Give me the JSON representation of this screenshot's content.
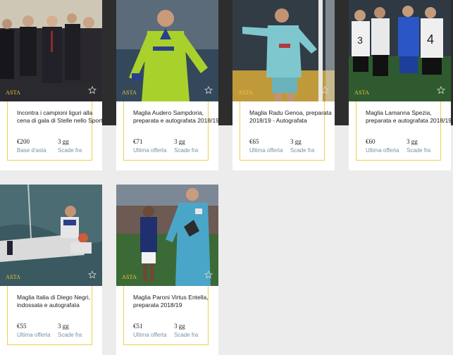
{
  "colors": {
    "accent": "#f1cf50",
    "tag": "#f3c738",
    "label": "#7a8fa6",
    "dark_band": "#2d2d2d",
    "page_bg": "#ececec"
  },
  "cards": [
    {
      "tag": "ASTA",
      "title": "Incontra i campioni liguri alla cena di gala di Stelle nello Sport",
      "price": "€200",
      "price_label": "Base d'asta",
      "days": "3 gg",
      "days_label": "Scade fra",
      "icon": "star-outline-icon"
    },
    {
      "tag": "ASTA",
      "title": "Maglia Audero Sampdoria, preparata e autografata 2018/19",
      "price": "€71",
      "price_label": "Ultima offerta",
      "days": "3 gg",
      "days_label": "Scade fra",
      "icon": "star-outline-icon"
    },
    {
      "tag": "ASTA",
      "title": "Maglia Radu Genoa, preparata 2018/19 - Autografata",
      "price": "€65",
      "price_label": "Ultima offerta",
      "days": "3 gg",
      "days_label": "Scade fra",
      "icon": "star-outline-icon"
    },
    {
      "tag": "ASTA",
      "title": "Maglia Lamanna Spezia, preparata e autografata 2018/19",
      "price": "€60",
      "price_label": "Ultima offerta",
      "days": "3 gg",
      "days_label": "Scade fra",
      "icon": "star-outline-icon"
    },
    {
      "tag": "ASTA",
      "title": "Maglia Italia di Diego Negri, indossata e autografata",
      "price": "€55",
      "price_label": "Ultima offerta",
      "days": "3 gg",
      "days_label": "Scade fra",
      "icon": "star-outline-icon"
    },
    {
      "tag": "ASTA",
      "title": "Maglia Paroni Virtus Entella, preparata 2018/19",
      "price": "€51",
      "price_label": "Ultima offerta",
      "days": "3 gg",
      "days_label": "Scade fra",
      "icon": "star-outline-icon"
    }
  ]
}
